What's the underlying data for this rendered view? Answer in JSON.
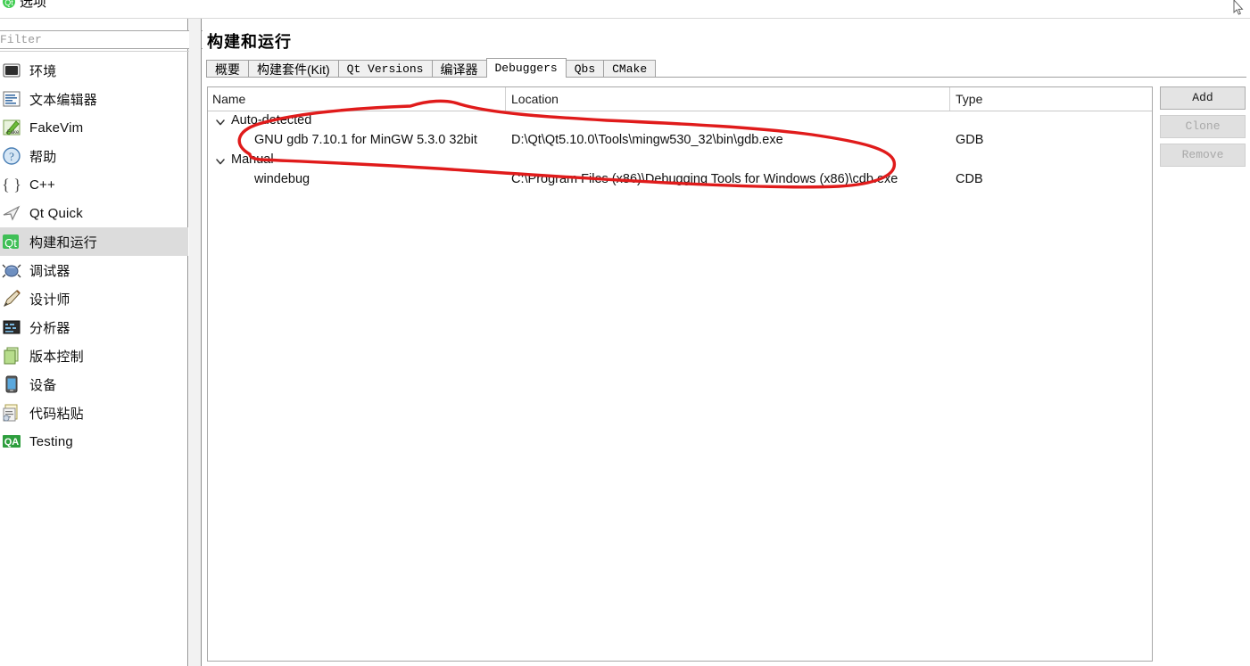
{
  "window": {
    "title": "选项",
    "icon": "qt-creator-icon"
  },
  "sidebar": {
    "filter_placeholder": "Filter",
    "filter_value": "",
    "items": [
      {
        "label": "环境",
        "icon": "environment-icon",
        "selected": false
      },
      {
        "label": "文本编辑器",
        "icon": "text-editor-icon",
        "selected": false
      },
      {
        "label": "FakeVim",
        "icon": "fakevim-icon",
        "selected": false
      },
      {
        "label": "帮助",
        "icon": "help-icon",
        "selected": false
      },
      {
        "label": "C++",
        "icon": "cpp-icon",
        "selected": false
      },
      {
        "label": "Qt Quick",
        "icon": "qt-quick-icon",
        "selected": false
      },
      {
        "label": "构建和运行",
        "icon": "build-run-icon",
        "selected": true
      },
      {
        "label": "调试器",
        "icon": "debugger-icon",
        "selected": false
      },
      {
        "label": "设计师",
        "icon": "designer-icon",
        "selected": false
      },
      {
        "label": "分析器",
        "icon": "analyzer-icon",
        "selected": false
      },
      {
        "label": "版本控制",
        "icon": "version-control-icon",
        "selected": false
      },
      {
        "label": "设备",
        "icon": "devices-icon",
        "selected": false
      },
      {
        "label": "代码粘贴",
        "icon": "code-paste-icon",
        "selected": false
      },
      {
        "label": "Testing",
        "icon": "testing-icon",
        "selected": false
      }
    ]
  },
  "main": {
    "page_title": "构建和运行",
    "tabs": [
      {
        "label": "概要",
        "active": false,
        "cjk": true
      },
      {
        "label": "构建套件(Kit)",
        "active": false,
        "cjk": true
      },
      {
        "label": "Qt Versions",
        "active": false,
        "cjk": false
      },
      {
        "label": "编译器",
        "active": false,
        "cjk": true
      },
      {
        "label": "Debuggers",
        "active": true,
        "cjk": false
      },
      {
        "label": "Qbs",
        "active": false,
        "cjk": false
      },
      {
        "label": "CMake",
        "active": false,
        "cjk": false
      }
    ],
    "table": {
      "columns": [
        "Name",
        "Location",
        "Type"
      ],
      "rows": [
        {
          "kind": "group",
          "expanded": true,
          "name": "Auto-detected",
          "location": "",
          "type": ""
        },
        {
          "kind": "child",
          "name": "GNU gdb 7.10.1 for MinGW 5.3.0 32bit",
          "location": "D:\\Qt\\Qt5.10.0\\Tools\\mingw530_32\\bin\\gdb.exe",
          "type": "GDB"
        },
        {
          "kind": "group",
          "expanded": true,
          "name": "Manual",
          "location": "",
          "type": ""
        },
        {
          "kind": "child",
          "name": "windebug",
          "location": "C:\\Program Files (x86)\\Debugging Tools for Windows (x86)\\cdb.exe",
          "type": "CDB"
        }
      ]
    },
    "buttons": [
      {
        "label": "Add",
        "enabled": true
      },
      {
        "label": "Clone",
        "enabled": false
      },
      {
        "label": "Remove",
        "enabled": false
      }
    ]
  },
  "annotation": {
    "color": "#e01b1b",
    "shape": "hand-drawn-ellipse",
    "target": "GNU gdb 7.10.1 for MinGW 5.3.0 32bit"
  }
}
